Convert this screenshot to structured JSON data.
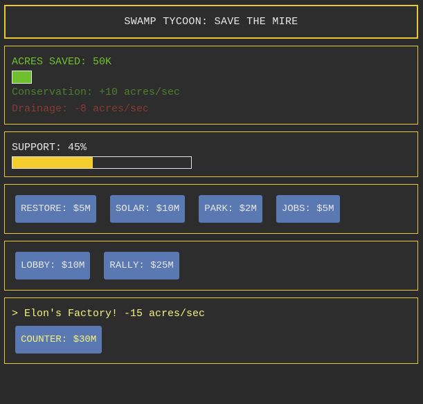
{
  "title": "SWAMP TYCOON: SAVE THE MIRE",
  "acres": {
    "label": "ACRES SAVED: 50K",
    "conservation": "Conservation: +10 acres/sec",
    "drainage": "Drainage: -8 acres/sec"
  },
  "support": {
    "label": "SUPPORT: 45%",
    "fraction": 0.45
  },
  "actions_row1": [
    {
      "label": "RESTORE: $5M"
    },
    {
      "label": "SOLAR: $10M"
    },
    {
      "label": "PARK: $2M"
    },
    {
      "label": "JOBS: $5M"
    }
  ],
  "actions_row2": [
    {
      "label": "LOBBY: $10M"
    },
    {
      "label": "RALLY: $25M"
    }
  ],
  "event": {
    "text": "> Elon's Factory! -15 acres/sec",
    "counter_label": "COUNTER: $30M"
  },
  "colors": {
    "accent_border": "#e7c83a",
    "positive": "#6fc02f",
    "negative": "#8a3a30",
    "support_fill": "#f3cd2d",
    "button": "#5a78b1",
    "event_text": "#f5f07e"
  }
}
